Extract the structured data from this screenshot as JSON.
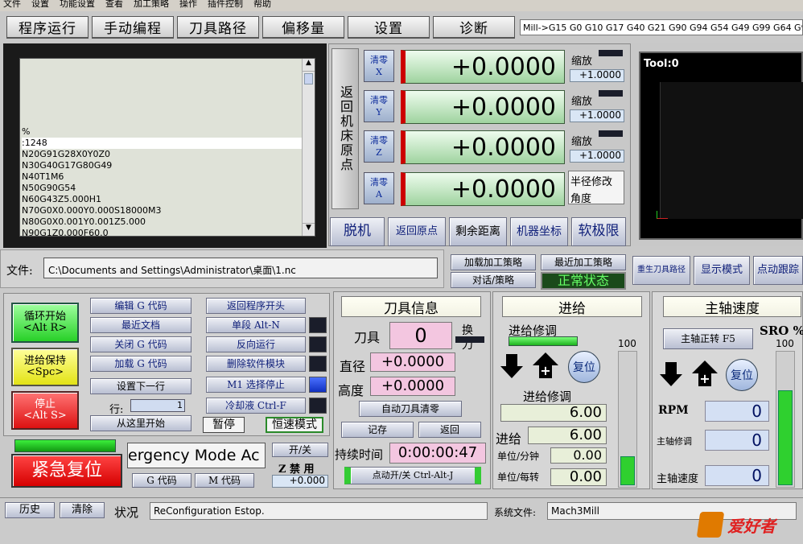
{
  "menu": [
    "文件",
    "设置",
    "功能设置",
    "查看",
    "加工策略",
    "操作",
    "插件控制",
    "帮助"
  ],
  "tabs": [
    "程序运行",
    "手动编程",
    "刀具路径",
    "偏移量",
    "设置",
    "诊断"
  ],
  "modal_line": "Mill->G15  G0 G10 G17 G40 G21 G90 G94 G54 G49 G99 G64 G9",
  "gcode": {
    "lines": [
      "%",
      ":1248",
      "N20G91G28X0Y0Z0",
      "N30G40G17G80G49",
      "N40T1M6",
      "N50G90G54",
      "N60G43Z5.000H1",
      "N70G0X0.000Y0.000S18000M3",
      "N80G0X0.001Y0.001Z5.000",
      "N90G1Z0.000F60.0"
    ]
  },
  "dro": {
    "ref_label": "返回机床原点",
    "axes": [
      {
        "zero_top": "清零",
        "zero_axis": "X",
        "value": "+0.0000",
        "scale_label": "缩放",
        "scale_value": "+1.0000"
      },
      {
        "zero_top": "清零",
        "zero_axis": "Y",
        "value": "+0.0000",
        "scale_label": "缩放",
        "scale_value": "+1.0000"
      },
      {
        "zero_top": "清零",
        "zero_axis": "Z",
        "value": "+0.0000",
        "scale_label": "缩放",
        "scale_value": "+1.0000"
      },
      {
        "zero_top": "清零",
        "zero_axis": "A",
        "value": "+0.0000",
        "radius_label": "半径修改",
        "angle_label": "角度"
      }
    ],
    "buttons": [
      "脱机",
      "返回原点",
      "剩余距离",
      "机器坐标",
      "软极限"
    ]
  },
  "toolpath": {
    "label": "Tool:0"
  },
  "file": {
    "label": "文件:",
    "path": "C:\\Documents and Settings\\Administrator\\桌面\\1.nc"
  },
  "strategy": {
    "load": "加载加工策略",
    "recent": "最近加工策略",
    "dialog": "对话/策略",
    "state": "正常状态",
    "regen": "重生刀具路径",
    "display": "显示模式",
    "jog": "点动跟踪"
  },
  "program": {
    "cycle_start": "循环开始",
    "cycle_start_key": "<Alt R>",
    "feed_hold": "进给保持",
    "feed_hold_key": "<Spc>",
    "stop": "停止",
    "stop_key": "<Alt S>",
    "edit_g": "编辑 G 代码",
    "recent_file": "最近文档",
    "close_g": "关闭 G 代码",
    "load_g": "加载 G 代码",
    "set_next": "设置下一行",
    "line_label": "行:",
    "line_value": "1",
    "run_from": "从这里开始",
    "rewind": "返回程序开头",
    "single": "单段 Alt-N",
    "reverse": "反向运行",
    "delete": "删除软件模块",
    "m1": "M1 选择停止",
    "coolant": "冷却液 Ctrl-F",
    "pause": "暂停",
    "cv_mode": "恒速模式"
  },
  "reset": {
    "label": "紧急复位",
    "mode_text": "ergency Mode Ac",
    "gcode_btn": "G 代码",
    "mcode_btn": "M 代码",
    "on_off": "开/关",
    "z_inhibit": "Z 禁 用",
    "z_value": "+0.000"
  },
  "tool": {
    "title": "刀具信息",
    "tool_label": "刀具",
    "tool_value": "0",
    "change": "换刀",
    "dia_label": "直径",
    "dia_value": "+0.0000",
    "height_label": "高度",
    "height_value": "+0.0000",
    "auto_zero": "自动刀具清零",
    "remember": "记存",
    "return": "返回",
    "elapsed_label": "持续时间",
    "elapsed_value": "0:00:00:47",
    "jog_onoff": "点动开/关 Ctrl-Alt-J"
  },
  "feed": {
    "title": "进给",
    "override_label": "进给修调",
    "reset": "复位",
    "pct": "100",
    "override_label2": "进给修调",
    "override_value": "6.00",
    "feed_label": "进给",
    "feed_value": "6.00",
    "upm_label": "单位/分钟",
    "upm_value": "0.00",
    "upr_label": "单位/每转",
    "upr_value": "0.00",
    "override_fraction": 0.22
  },
  "spindle": {
    "title": "主轴速度",
    "cw": "主轴正转 F5",
    "sro_label": "SRO %",
    "sro_value": "100",
    "reset": "复位",
    "rpm_label": "RPM",
    "rpm_value": "0",
    "override_label": "主轴修调",
    "override_value": "0",
    "speed_label": "主轴速度",
    "speed_value": "0",
    "override_fraction": 0.72
  },
  "status": {
    "history": "历史",
    "clear": "清除",
    "label": "状况",
    "text": "ReConfiguration Estop.",
    "profile_label": "系统文件:",
    "profile": "Mach3Mill",
    "logo": "爱好者"
  }
}
